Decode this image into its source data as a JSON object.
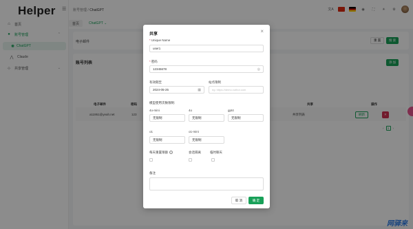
{
  "app": {
    "logo": "Helper"
  },
  "sidebar": {
    "items": [
      {
        "label": "首页",
        "icon": "home-icon"
      },
      {
        "label": "账号管理",
        "icon": "user-icon"
      },
      {
        "label": "ChatGPT",
        "icon": "chatgpt-icon"
      },
      {
        "label": "Claude",
        "icon": "claude-icon"
      },
      {
        "label": "共享管理",
        "icon": "share-icon"
      }
    ]
  },
  "header": {
    "breadcrumb_parent": "账号管理",
    "breadcrumb_current": "ChatGPT",
    "lang_label": "文A"
  },
  "tabs": [
    {
      "label": "首页"
    },
    {
      "label": "ChatGPT ⌄"
    }
  ],
  "search_card": {
    "email_label": "电子邮件",
    "reset_label": "重 置",
    "search_label": "搜 索"
  },
  "list_card": {
    "title": "账号列表",
    "add_label": "添 加",
    "columns": [
      "电子邮件",
      "密码",
      "共享",
      "操作"
    ],
    "row": {
      "email": "a11951@yeah.net",
      "password": "123",
      "share_label": "共享列表",
      "refresh_label": "刷新"
    },
    "page": "1"
  },
  "modal": {
    "title": "共享",
    "unique_name_label": "Unique Name",
    "unique_name_value": "user1",
    "password_label": "密码",
    "password_value": "12345678",
    "expire_label": "有效期至",
    "expire_value": "2024-05-25",
    "site_limit_label": "站点限制",
    "site_limit_placeholder": "eg: https://demo.xuthor.com",
    "model_limit_label": "模型使用次数限制:",
    "models": [
      {
        "name": "4o-mini",
        "value": "无限制"
      },
      {
        "name": "4o",
        "value": "无限制"
      },
      {
        "name": "gpt4",
        "value": "无限制"
      },
      {
        "name": "o1",
        "value": "无限制"
      },
      {
        "name": "o1-mini",
        "value": "无限制"
      }
    ],
    "checks": [
      {
        "label": "每天重置限额"
      },
      {
        "label": "会话隔离"
      },
      {
        "label": "临时聊天"
      }
    ],
    "remark_label": "备注",
    "cancel_label": "取 消",
    "confirm_label": "确 定"
  },
  "watermark": "网驿来",
  "colors": {
    "accent": "#18a058",
    "danger": "#d03050"
  }
}
